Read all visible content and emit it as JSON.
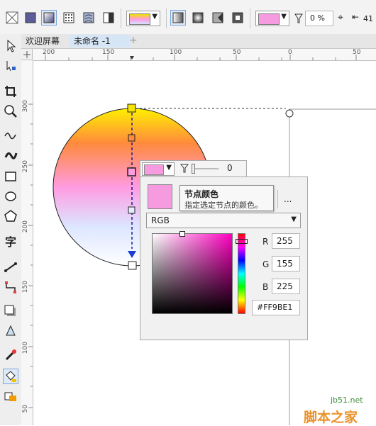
{
  "toolbar": {
    "opacity_value": "0 %",
    "offset_value": "41",
    "fill_color": "#f79be1"
  },
  "tabs": [
    {
      "label": "欢迎屏幕"
    },
    {
      "label": "未命名 -1"
    },
    {
      "label": "+"
    }
  ],
  "ruler_h": {
    "ticks": [
      "200",
      "150",
      "100",
      "50",
      "0",
      "50"
    ]
  },
  "ruler_v": {
    "ticks": [
      "300",
      "250",
      "200",
      "150",
      "100",
      "50"
    ]
  },
  "node_toolbar": {
    "opacity_value": "0",
    "swatch_color": "#f79be1"
  },
  "tooltip": {
    "title": "节点颜色",
    "description": "指定选定节点的颜色。"
  },
  "picker": {
    "more_label": "...",
    "model_label": "RGB",
    "r_label": "R",
    "g_label": "G",
    "b_label": "B",
    "r_value": "255",
    "g_value": "155",
    "b_value": "225",
    "hex_value": "#FF9BE1",
    "swatch_color": "#f79be1"
  },
  "watermark": {
    "site": "jb51.net",
    "name": "脚本之家"
  }
}
